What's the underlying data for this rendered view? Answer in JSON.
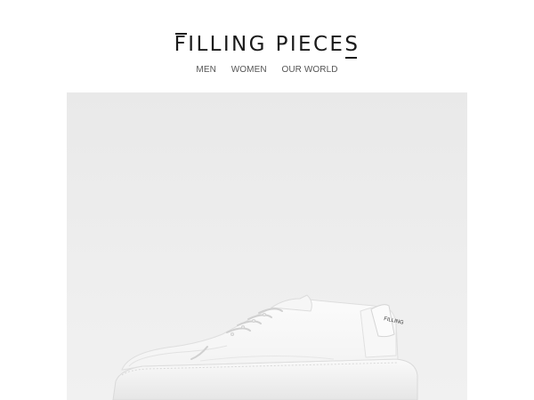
{
  "brand": {
    "name": "FILLING PIECES"
  },
  "nav": {
    "items": [
      {
        "label": "MEN"
      },
      {
        "label": "WOMEN"
      },
      {
        "label": "OUR WORLD"
      }
    ]
  },
  "hero": {
    "image": "white-sneaker-product-photo",
    "shoe_tab_text": "FILLING"
  },
  "colors": {
    "background": "#ffffff",
    "hero_background": "#ececec",
    "logo": "#1a1a1a",
    "nav_text": "#555555"
  }
}
